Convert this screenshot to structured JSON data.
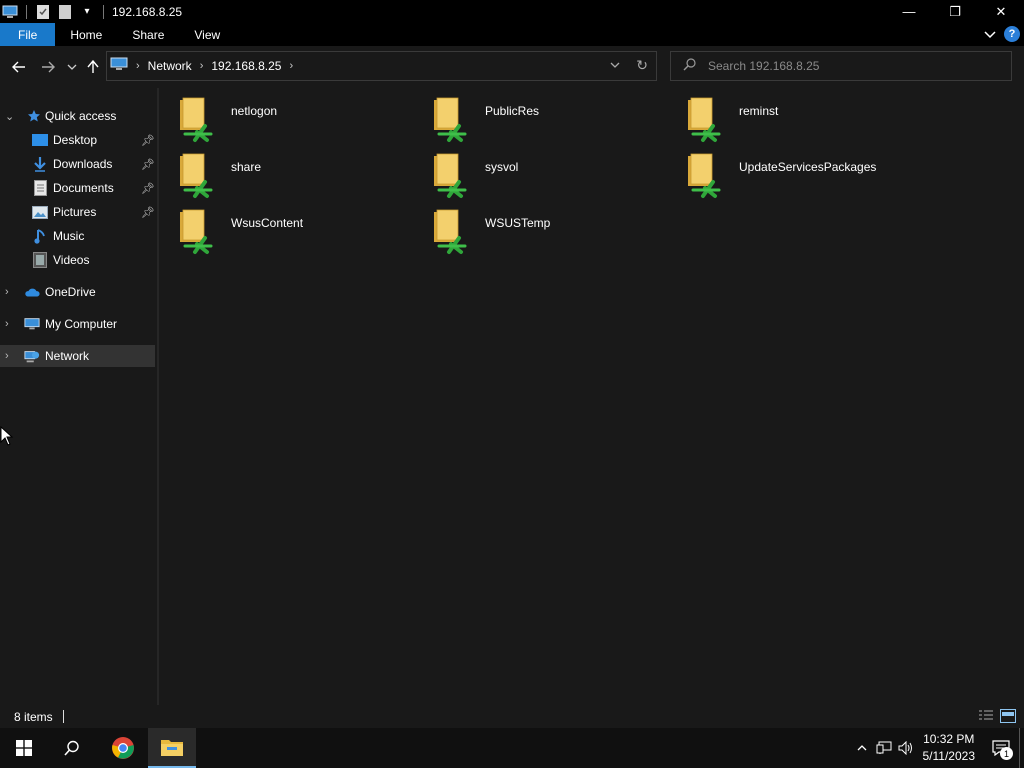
{
  "window": {
    "title": "192.168.8.25",
    "controls": {
      "minimize": "—",
      "maximize": "❐",
      "close": "✕"
    }
  },
  "ribbon": {
    "tabs": [
      "File",
      "Home",
      "Share",
      "View"
    ],
    "expand_icon": "chevron-down-icon",
    "help_label": "?"
  },
  "address": {
    "crumbs": [
      "Network",
      "192.168.8.25"
    ],
    "refresh_icon": "refresh-icon"
  },
  "search": {
    "placeholder": "Search 192.168.8.25"
  },
  "nav": {
    "quick_access": "Quick access",
    "items": [
      {
        "label": "Desktop",
        "icon": "desktop-icon",
        "pinned": true
      },
      {
        "label": "Downloads",
        "icon": "downloads-icon",
        "pinned": true
      },
      {
        "label": "Documents",
        "icon": "documents-icon",
        "pinned": true
      },
      {
        "label": "Pictures",
        "icon": "pictures-icon",
        "pinned": true
      },
      {
        "label": "Music",
        "icon": "music-icon",
        "pinned": false
      },
      {
        "label": "Videos",
        "icon": "videos-icon",
        "pinned": false
      }
    ],
    "onedrive": "OneDrive",
    "my_computer": "My Computer",
    "network": "Network"
  },
  "content": {
    "shares": [
      "netlogon",
      "PublicRes",
      "reminst",
      "share",
      "sysvol",
      "UpdateServicesPackages",
      "WsusContent",
      "WSUSTemp"
    ]
  },
  "status": {
    "items_text": "8 items"
  },
  "taskbar": {
    "time": "10:32 PM",
    "date": "5/11/2023",
    "notification_count": "1"
  },
  "colors": {
    "accent": "#1979ca",
    "background": "#191919",
    "folder": "#e8c55a",
    "share_green": "#3fbf4a"
  }
}
